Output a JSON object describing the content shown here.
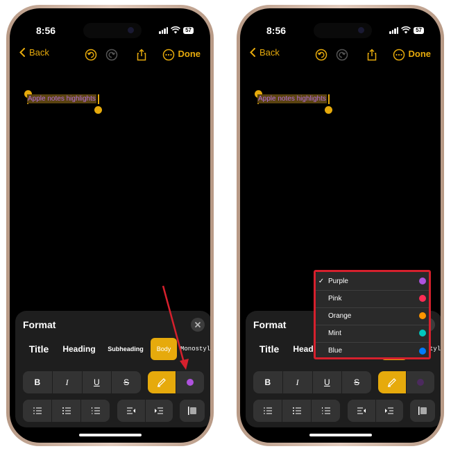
{
  "status": {
    "time": "8:56",
    "battery": "57"
  },
  "nav": {
    "back_label": "Back",
    "done_label": "Done"
  },
  "note": {
    "text": "Apple notes highlights"
  },
  "format": {
    "title": "Format",
    "styles": {
      "title": "Title",
      "heading": "Heading",
      "subheading": "Subheading",
      "body": "Body",
      "monostyled": "Monostyled"
    },
    "text_buttons": {
      "bold": "B",
      "italic": "I",
      "underline": "U",
      "strikethrough": "S"
    }
  },
  "highlight_menu": {
    "items": [
      {
        "label": "Purple",
        "color": "#af52de",
        "checked": true
      },
      {
        "label": "Pink",
        "color": "#ff2d55",
        "checked": false
      },
      {
        "label": "Orange",
        "color": "#ff9500",
        "checked": false
      },
      {
        "label": "Mint",
        "color": "#00c7be",
        "checked": false
      },
      {
        "label": "Blue",
        "color": "#007aff",
        "checked": false
      }
    ],
    "checkmark": "✓"
  },
  "colors": {
    "accent": "#e6aa0c",
    "highlight_color": "#af52de",
    "annotation_red": "#d6202d"
  }
}
